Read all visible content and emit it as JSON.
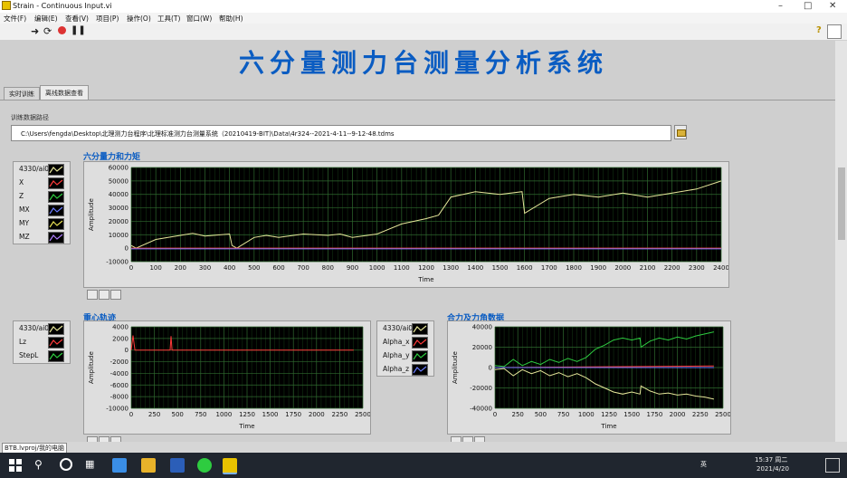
{
  "window": {
    "title": "Strain - Continuous Input.vi"
  },
  "menu": [
    "文件(F)",
    "编辑(E)",
    "查看(V)",
    "项目(P)",
    "操作(O)",
    "工具(T)",
    "窗口(W)",
    "帮助(H)"
  ],
  "header": {
    "title": "六分量测力台测量分析系统"
  },
  "tabs": [
    {
      "label": "实时训练"
    },
    {
      "label": "离线数据查看"
    }
  ],
  "path": {
    "label": "训练数据路径",
    "value": "C:\\Users\\fengda\\Desktop\\北理测力台程序\\北理标准测力台测量系统（20210419-BIT)\\Data\\4r324--2021-4-11--9-12-48.tdms"
  },
  "charts_meta": {
    "main_title": "六分量力和力矩",
    "cop_title": "重心轨迹",
    "resultant_title": "合力及力角数据"
  },
  "legends": {
    "main": [
      "4330/ai0",
      "X",
      "Z",
      "MX",
      "MY",
      "MZ"
    ],
    "cop": [
      "4330/ai0",
      "Lz",
      "StepL"
    ],
    "angle": [
      "4330/ai0",
      "Alpha_x",
      "Alpha_y",
      "Alpha_z"
    ]
  },
  "colors": {
    "plot_bg": "#000000",
    "grid": "#2f6a2f",
    "yellow": "#e6e69a",
    "green": "#2ecc40",
    "red": "#ff3a3a",
    "blue": "#6a7cff",
    "title_blue": "#0a5cc2"
  },
  "status": {
    "project": "BTB.lvproj/我的电脑"
  },
  "taskbar": {
    "ime": "英",
    "time": "15:37 周二",
    "date": "2021/4/20"
  },
  "chart_data": [
    {
      "type": "line",
      "title": "六分量力和力矩",
      "xlabel": "Time",
      "ylabel": "Amplitude",
      "xlim": [
        0,
        2400
      ],
      "ylim": [
        -10000,
        60000
      ],
      "xticks": [
        0,
        100,
        200,
        300,
        400,
        500,
        600,
        700,
        800,
        900,
        1000,
        1100,
        1200,
        1300,
        1400,
        1500,
        1600,
        1700,
        1800,
        1900,
        2000,
        2100,
        2200,
        2300,
        2400
      ],
      "yticks": [
        60000,
        50000,
        40000,
        30000,
        20000,
        10000,
        0,
        -10000
      ],
      "series": [
        {
          "color": "#e6e69a",
          "points": [
            [
              0,
              2000
            ],
            [
              20,
              0
            ],
            [
              100,
              6500
            ],
            [
              200,
              9500
            ],
            [
              250,
              11000
            ],
            [
              300,
              9000
            ],
            [
              400,
              10500
            ],
            [
              410,
              2000
            ],
            [
              430,
              0
            ],
            [
              500,
              8000
            ],
            [
              550,
              9500
            ],
            [
              600,
              8000
            ],
            [
              700,
              10500
            ],
            [
              800,
              9500
            ],
            [
              850,
              10500
            ],
            [
              900,
              8000
            ],
            [
              1000,
              10500
            ],
            [
              1100,
              18000
            ],
            [
              1200,
              22000
            ],
            [
              1250,
              24500
            ],
            [
              1300,
              38000
            ],
            [
              1350,
              40000
            ],
            [
              1400,
              42000
            ],
            [
              1500,
              40000
            ],
            [
              1590,
              42000
            ],
            [
              1600,
              26000
            ],
            [
              1700,
              37000
            ],
            [
              1800,
              40000
            ],
            [
              1900,
              38000
            ],
            [
              2000,
              41000
            ],
            [
              2100,
              38000
            ],
            [
              2200,
              41000
            ],
            [
              2300,
              44000
            ],
            [
              2400,
              50000
            ]
          ]
        },
        {
          "color": "#ff3a3a",
          "points": [
            [
              0,
              0
            ],
            [
              2400,
              0
            ]
          ]
        },
        {
          "color": "#6a7cff",
          "points": [
            [
              0,
              -500
            ],
            [
              2400,
              -500
            ]
          ]
        }
      ]
    },
    {
      "type": "line",
      "title": "重心轨迹",
      "xlabel": "Time",
      "ylabel": "Amplitude",
      "xlim": [
        0,
        2500
      ],
      "ylim": [
        -10000,
        4000
      ],
      "xticks": [
        0,
        250,
        500,
        750,
        1000,
        1250,
        1500,
        1750,
        2000,
        2250,
        2500
      ],
      "yticks": [
        4000,
        2000,
        0,
        -2000,
        -4000,
        -6000,
        -8000,
        -10000
      ],
      "series": [
        {
          "color": "#ff3a3a",
          "points": [
            [
              0,
              0
            ],
            [
              20,
              2500
            ],
            [
              40,
              0
            ],
            [
              420,
              0
            ],
            [
              430,
              2400
            ],
            [
              440,
              0
            ],
            [
              2400,
              0
            ]
          ]
        }
      ]
    },
    {
      "type": "line",
      "title": "合力及力角数据",
      "xlabel": "Time",
      "ylabel": "Amplitude",
      "xlim": [
        0,
        2500
      ],
      "ylim": [
        -40000,
        40000
      ],
      "xticks": [
        0,
        250,
        500,
        750,
        1000,
        1250,
        1500,
        1750,
        2000,
        2250,
        2500
      ],
      "yticks": [
        40000,
        20000,
        0,
        -20000,
        -40000
      ],
      "series": [
        {
          "color": "#2ecc40",
          "points": [
            [
              0,
              2000
            ],
            [
              100,
              1000
            ],
            [
              200,
              8000
            ],
            [
              300,
              2000
            ],
            [
              400,
              6000
            ],
            [
              500,
              3000
            ],
            [
              600,
              8000
            ],
            [
              700,
              5000
            ],
            [
              800,
              9000
            ],
            [
              900,
              6000
            ],
            [
              1000,
              10000
            ],
            [
              1100,
              18000
            ],
            [
              1200,
              22000
            ],
            [
              1300,
              27000
            ],
            [
              1400,
              29000
            ],
            [
              1500,
              27000
            ],
            [
              1590,
              29000
            ],
            [
              1600,
              20000
            ],
            [
              1700,
              26000
            ],
            [
              1800,
              29000
            ],
            [
              1900,
              27000
            ],
            [
              2000,
              30000
            ],
            [
              2100,
              28000
            ],
            [
              2200,
              31000
            ],
            [
              2300,
              33000
            ],
            [
              2400,
              35000
            ]
          ]
        },
        {
          "color": "#e6e69a",
          "points": [
            [
              0,
              -2000
            ],
            [
              100,
              -1000
            ],
            [
              200,
              -8000
            ],
            [
              300,
              -2000
            ],
            [
              400,
              -6000
            ],
            [
              500,
              -3000
            ],
            [
              600,
              -8000
            ],
            [
              700,
              -5000
            ],
            [
              800,
              -9000
            ],
            [
              900,
              -6000
            ],
            [
              1000,
              -10000
            ],
            [
              1100,
              -16000
            ],
            [
              1200,
              -20000
            ],
            [
              1300,
              -24000
            ],
            [
              1400,
              -26000
            ],
            [
              1500,
              -24000
            ],
            [
              1590,
              -26000
            ],
            [
              1600,
              -18000
            ],
            [
              1700,
              -23000
            ],
            [
              1800,
              -26000
            ],
            [
              1900,
              -25000
            ],
            [
              2000,
              -27000
            ],
            [
              2100,
              -26000
            ],
            [
              2200,
              -28000
            ],
            [
              2300,
              -29000
            ],
            [
              2400,
              -31000
            ]
          ]
        },
        {
          "color": "#ff3a3a",
          "points": [
            [
              0,
              0
            ],
            [
              2400,
              1500
            ]
          ]
        },
        {
          "color": "#6a7cff",
          "points": [
            [
              0,
              0
            ],
            [
              2400,
              0
            ]
          ]
        }
      ]
    }
  ]
}
